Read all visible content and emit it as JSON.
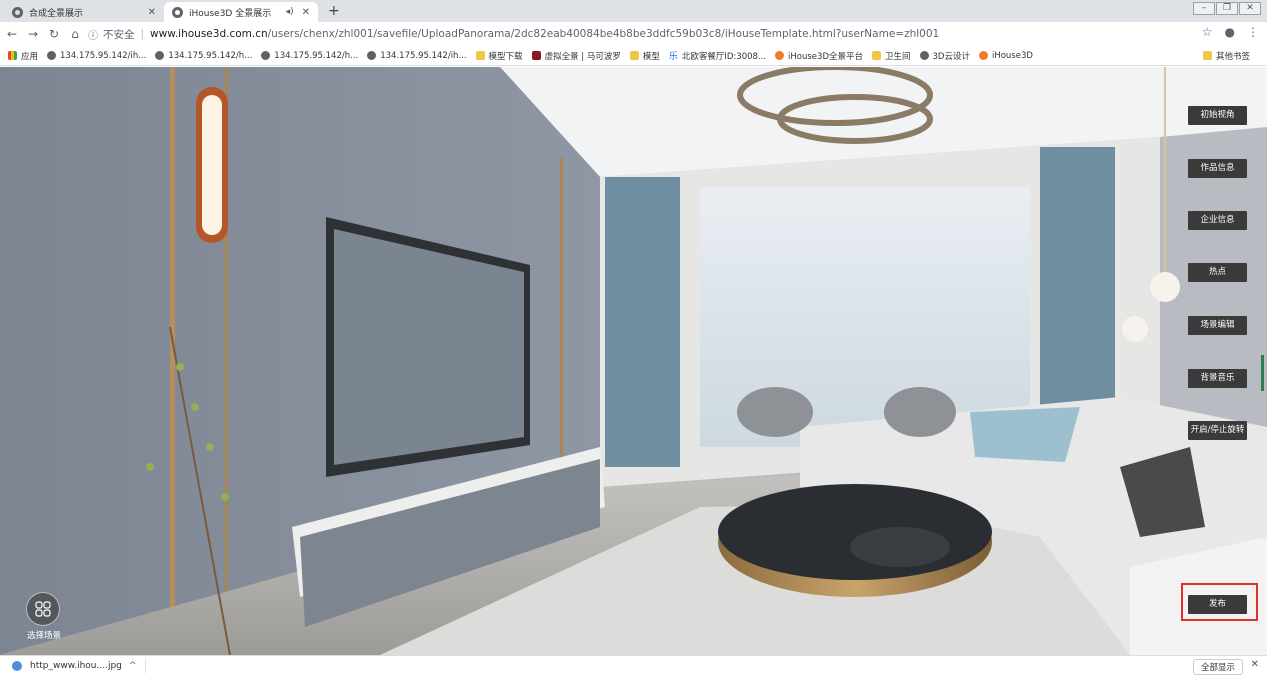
{
  "tabs": [
    {
      "title": "合成全景展示",
      "active": false
    },
    {
      "title": "iHouse3D 全景展示",
      "active": true
    }
  ],
  "address": {
    "security": "不安全",
    "host": "www.ihouse3d.com.cn",
    "path": "/users/chenx/zhl001/savefile/UploadPanorama/2dc82eab40084be4b8be3ddfc59b03c8/iHouseTemplate.html?userName=zhl001"
  },
  "bookmarks": [
    {
      "label": "应用",
      "icon": "apps-grid-icon"
    },
    {
      "label": "134.175.95.142/ih...",
      "icon": "globe-icon"
    },
    {
      "label": "134.175.95.142/h...",
      "icon": "globe-icon"
    },
    {
      "label": "134.175.95.142/h...",
      "icon": "globe-icon"
    },
    {
      "label": "134.175.95.142/ih...",
      "icon": "globe-icon"
    },
    {
      "label": "模型下载",
      "icon": "folder-icon"
    },
    {
      "label": "虚拟全景 | 马可波罗",
      "icon": "site-icon"
    },
    {
      "label": "模型",
      "icon": "folder-icon"
    },
    {
      "label": "北欧客餐厅ID:3008...",
      "icon": "music-icon"
    },
    {
      "label": "iHouse3D全景平台",
      "icon": "ihouse-icon"
    },
    {
      "label": "卫生间",
      "icon": "folder-icon"
    },
    {
      "label": "3D云设计",
      "icon": "globe-icon"
    },
    {
      "label": "iHouse3D",
      "icon": "ihouse-icon"
    }
  ],
  "other_bookmarks": "其他书签",
  "panel_buttons": [
    {
      "label": "初始视角"
    },
    {
      "label": "作品信息"
    },
    {
      "label": "企业信息"
    },
    {
      "label": "热点"
    },
    {
      "label": "场景编辑"
    },
    {
      "label": "背景音乐"
    },
    {
      "label": "开启/停止旋转"
    }
  ],
  "publish_label": "发布",
  "scene_select_label": "选择场景",
  "download": {
    "filename": "http_www.ihou....jpg",
    "show_all": "全部显示"
  },
  "colors": {
    "highlight": "#e0322d",
    "panel_button": "#3a3a3a"
  }
}
